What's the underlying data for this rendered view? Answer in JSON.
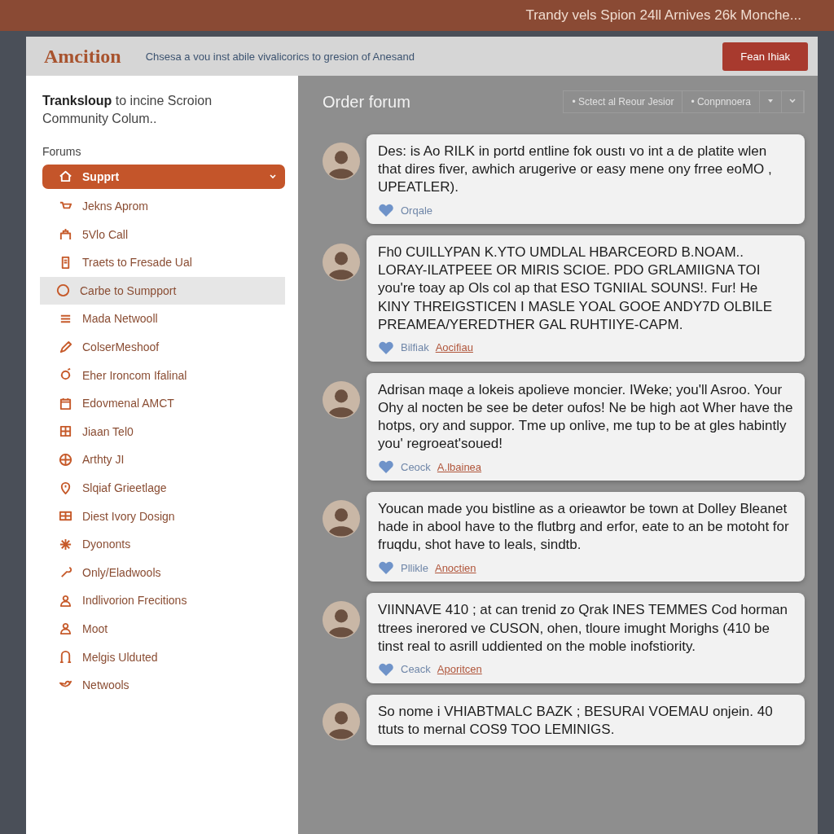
{
  "banner": {
    "headline": "Trandy vels Spion 24ll Arnives 26k Monche..."
  },
  "header": {
    "logo": "Amcition",
    "tagline": "Chsesa a vou inst abile vivalicorics to gresion of Anesand",
    "button": "Fean Ihiak"
  },
  "sidebar": {
    "title": "Tranksloup",
    "subtitle": " to incine Scroion Community Colum..",
    "section": "Forums",
    "items": [
      {
        "label": "Supprt",
        "selected": true,
        "highlighted": false,
        "expanded": true
      },
      {
        "label": "Jekns Aprom",
        "selected": false,
        "highlighted": false
      },
      {
        "label": "5Vlo Call",
        "selected": false,
        "highlighted": false
      },
      {
        "label": "Traets to Fresade Ual",
        "selected": false,
        "highlighted": false
      },
      {
        "label": "Carbe to Sumpport",
        "selected": false,
        "highlighted": true
      },
      {
        "label": "Mada Netwooll",
        "selected": false,
        "highlighted": false
      },
      {
        "label": "ColserMeshoof",
        "selected": false,
        "highlighted": false
      },
      {
        "label": "Eher Ironcom Ifalinal",
        "selected": false,
        "highlighted": false
      },
      {
        "label": "Edovmenal AMCT",
        "selected": false,
        "highlighted": false
      },
      {
        "label": "Jiaan Tel0",
        "selected": false,
        "highlighted": false
      },
      {
        "label": "Arthty JI",
        "selected": false,
        "highlighted": false
      },
      {
        "label": "Slqiaf Grieetlage",
        "selected": false,
        "highlighted": false
      },
      {
        "label": "Diest Ivory Dosign",
        "selected": false,
        "highlighted": false
      },
      {
        "label": "Dyononts",
        "selected": false,
        "highlighted": false
      },
      {
        "label": "Only/Eladwools",
        "selected": false,
        "highlighted": false
      },
      {
        "label": "Indlivorion Frecitions",
        "selected": false,
        "highlighted": false
      },
      {
        "label": "Moot",
        "selected": false,
        "highlighted": false
      },
      {
        "label": "Melgis Ulduted",
        "selected": false,
        "highlighted": false
      },
      {
        "label": "Netwools",
        "selected": false,
        "highlighted": false
      }
    ]
  },
  "main": {
    "title": "Order forum",
    "filters": [
      "• Sctect al Reour Jesior",
      "• Conpnnoera"
    ],
    "messages": [
      {
        "text": "Des: is Ao RILK in portd entline fok oustı vo int a de platite wlen that dires fiver, awhich arugerive or easy mene ony frree eoMO , UPEATLER).",
        "reaction": "Orqale"
      },
      {
        "text": "Fh0 CUILLYPAN K.YTO UMDLAL HBARCEORD B.NOAM.. LORAY-ILATPEEE OR MIRIS SCIOE. PDO GRLAMIIGNA TOI you're toay ap Ols col ap that ESO TGNIIAL SOUNS!. Fur! He KINY THREIGSTICEN I MASLE YOAL GOOE ANDY7D OLBILE PREAMEA/YEREDTHER GAL RUHTIIYE-CAPM.",
        "reaction": "Bilfiak",
        "link": "Aocifiau"
      },
      {
        "text": "Adrisan maqe a lokeis apolieve moncier. IWeke; you'll Asroo. Your Ohy al nocten be see be deter oufos! Ne be high aot Wher have the hotps, ory and suppor. Tme up onlive, me tup to be at gles habintly you' regroeat'soued!",
        "reaction": "Ceock",
        "link": "A.lbainea"
      },
      {
        "text": "Youcan made you bistline as a orieawtor be town at Dolley Bleanet hade in abool have to the flutbrg and erfor, eate to an be motoht for fruqdu, shot have to leals, sindtb.",
        "reaction": "Pllikle",
        "link": "Anoctien"
      },
      {
        "text": "VIINNAVE 410 ; at can trenid zo Qrak INES TEMMES Cod horman ttrees inerored ve CUSON, ohen, tloure imught Morighs (410 be tinst real to asrill uddiented on the moble inofstiority.",
        "reaction": "Ceack",
        "link": "Aporitcen"
      },
      {
        "text": "So nome i VHIABTMALC BAZK ; BESURAI VOEMAU onjein. 40 ttuts to mernal COS9 TOO LEMINIGS."
      }
    ]
  }
}
